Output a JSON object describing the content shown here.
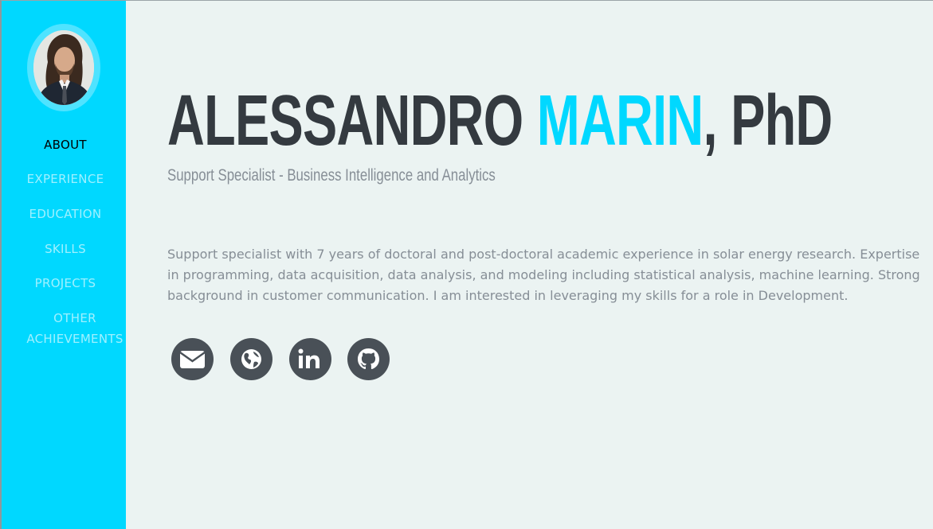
{
  "profile": {
    "first_name": "ALESSANDRO",
    "last_name": "MARIN",
    "suffix": ", PhD",
    "subtitle": "Support Specialist - Business Intelligence and Analytics",
    "summary": "Support specialist with 7 years of doctoral and post-doctoral academic experience in solar energy research. Expertise in programming, data acquisition, data analysis, and modeling including statistical analysis, machine learning. Strong background in customer communication. I am interested in leveraging my skills for a role in Development."
  },
  "nav": {
    "items": [
      {
        "label": "ABOUT",
        "active": true
      },
      {
        "label": "EXPERIENCE",
        "active": false
      },
      {
        "label": "EDUCATION",
        "active": false
      },
      {
        "label": "SKILLS",
        "active": false
      },
      {
        "label": "PROJECTS",
        "active": false
      },
      {
        "label": "OTHER ACHIEVEMENTS",
        "active": false
      }
    ]
  },
  "social": {
    "icons": [
      "envelope-icon",
      "globe-icon",
      "linkedin-icon",
      "github-icon"
    ]
  },
  "colors": {
    "accent": "#00d8ff",
    "sidebar": "#00d8ff",
    "heading": "#343a40",
    "muted": "#868e96",
    "background": "#ebf3f2",
    "social_button": "#495057"
  }
}
